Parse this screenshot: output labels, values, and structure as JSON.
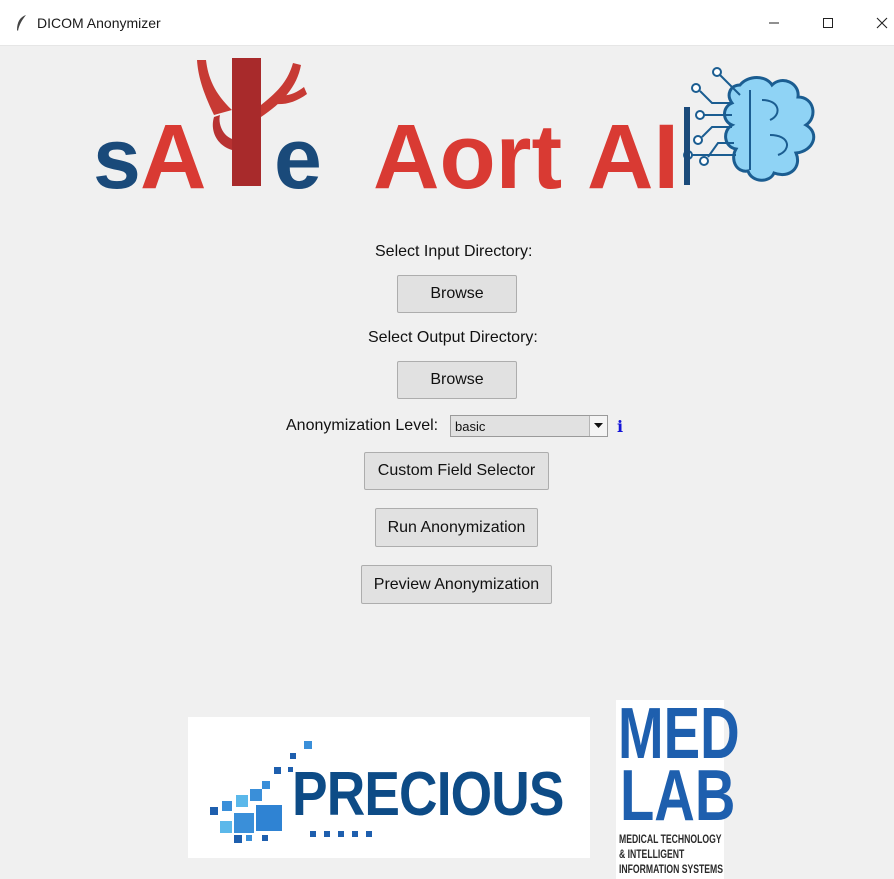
{
  "window": {
    "title": "DICOM Anonymizer"
  },
  "logo": {
    "text_s": "s",
    "text_a": "A",
    "text_e": "e",
    "text_aort": "Aort",
    "text_ai": "AI"
  },
  "input": {
    "label": "Select Input Directory:",
    "button": "Browse"
  },
  "output": {
    "label": "Select Output Directory:",
    "button": "Browse"
  },
  "anonymization": {
    "label": "Anonymization Level:",
    "selected": "basic",
    "info_icon": "i"
  },
  "buttons": {
    "custom_field_selector": "Custom Field Selector",
    "run": "Run Anonymization",
    "preview": "Preview Anonymization"
  },
  "partners": {
    "precious": "PRECIOUS",
    "medlab_line1": "MED",
    "medlab_line2": "LAB",
    "medlab_sub1": "MEDICAL TECHNOLOGY",
    "medlab_sub2": "& INTELLIGENT",
    "medlab_sub3": "INFORMATION SYSTEMS"
  },
  "colors": {
    "red": "#d93a33",
    "navy": "#1a4a7a",
    "blue": "#1e5fae",
    "cyan": "#5bb8ea"
  },
  "icons": [
    "feather-icon",
    "minimize-icon",
    "maximize-icon",
    "close-icon",
    "chevron-down-icon",
    "info-icon",
    "brain-circuit-icon",
    "aorta-icon"
  ]
}
